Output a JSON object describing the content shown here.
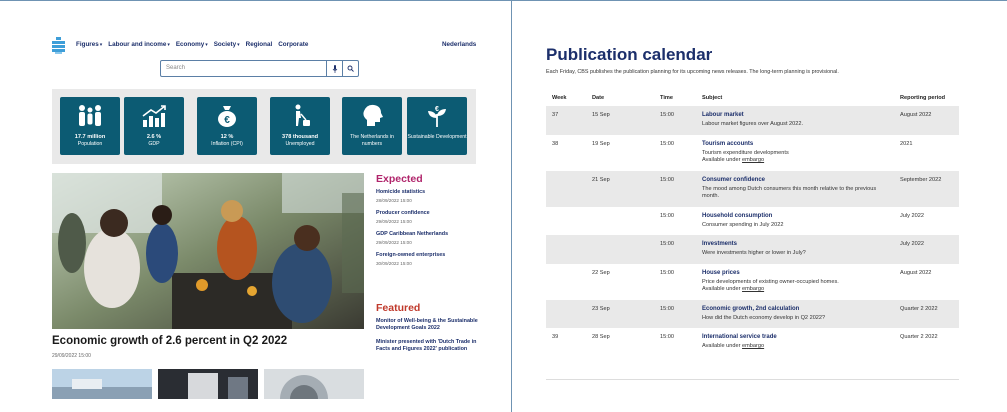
{
  "nav": {
    "items": [
      "Figures",
      "Labour and income",
      "Economy",
      "Society",
      "Regional",
      "Corporate"
    ],
    "has_caret": [
      true,
      true,
      true,
      true,
      false,
      false
    ],
    "language": "Nederlands"
  },
  "search": {
    "placeholder": "Search"
  },
  "tiles": [
    {
      "icon": "people-icon",
      "value": "17.7 million",
      "label": "Population"
    },
    {
      "icon": "growth-chart-icon",
      "value": "2.6 %",
      "label": "GDP"
    },
    {
      "icon": "money-bag-icon",
      "value": "12 %",
      "label": "Inflation (CPI)"
    },
    {
      "icon": "unemployed-person-icon",
      "value": "378 thousand",
      "label": "Unemployed"
    },
    {
      "icon": "head-profile-icon",
      "value": "",
      "label": "The Netherlands in numbers"
    },
    {
      "icon": "sustainable-plant-icon",
      "value": "",
      "label": "Sustainable Development"
    }
  ],
  "main_story": {
    "headline": "Economic growth of 2.6 percent in Q2 2022",
    "date": "29/09/2022 15:00"
  },
  "expected": {
    "heading": "Expected",
    "items": [
      {
        "title": "Homicide statistics",
        "date": "28/09/2022 15:00"
      },
      {
        "title": "Producer confidence",
        "date": "29/09/2022 15:00"
      },
      {
        "title": "GDP Caribbean Netherlands",
        "date": "29/09/2022 15:00"
      },
      {
        "title": "Foreign-owned enterprises",
        "date": "30/09/2022 15:00"
      }
    ]
  },
  "featured": {
    "heading": "Featured",
    "items": [
      {
        "title": "Monitor of Well-being & the Sustainable Development Goals 2022"
      },
      {
        "title": "Minister presented with 'Dutch Trade in Facts and Figures 2022' publication"
      }
    ]
  },
  "calendar": {
    "title": "Publication calendar",
    "intro": "Each Friday, CBS publishes the publication planning for its upcoming news releases. The long-term planning is provisional.",
    "columns": [
      "Week",
      "Date",
      "Time",
      "Subject",
      "Reporting period"
    ],
    "embargo_word": "embargo",
    "rows": [
      {
        "week": "37",
        "date": "15 Sep",
        "time": "15:00",
        "subject": "Labour market",
        "desc": "Labour market figures over August 2022.",
        "embargo": "",
        "period": "August 2022"
      },
      {
        "week": "38",
        "date": "19 Sep",
        "time": "15:00",
        "subject": "Tourism accounts",
        "desc": "Tourism expenditure developments",
        "embargo": "Available under",
        "period": "2021"
      },
      {
        "week": "",
        "date": "21 Sep",
        "time": "15:00",
        "subject": "Consumer confidence",
        "desc": "The mood among Dutch consumers this month relative to the previous month.",
        "embargo": "",
        "period": "September 2022"
      },
      {
        "week": "",
        "date": "",
        "time": "15:00",
        "subject": "Household consumption",
        "desc": "Consumer spending in July 2022",
        "embargo": "",
        "period": "July 2022"
      },
      {
        "week": "",
        "date": "",
        "time": "15:00",
        "subject": "Investments",
        "desc": "Were investments higher or lower in July?",
        "embargo": "",
        "period": "July 2022"
      },
      {
        "week": "",
        "date": "22 Sep",
        "time": "15:00",
        "subject": "House prices",
        "desc": "Price developments of existing owner-occupied homes.",
        "embargo": "Available under",
        "period": "August 2022"
      },
      {
        "week": "",
        "date": "23 Sep",
        "time": "15:00",
        "subject": "Economic growth, 2nd calculation",
        "desc": "How did the Dutch economy develop in Q2 2022?",
        "embargo": "",
        "period": "Quarter 2 2022"
      },
      {
        "week": "39",
        "date": "28 Sep",
        "time": "15:00",
        "subject": "International service trade",
        "desc": "",
        "embargo": "Available under",
        "period": "Quarter 2 2022"
      }
    ]
  },
  "colors": {
    "navy": "#1c2f6b",
    "tile_teal": "#0c5b73",
    "accent_magenta": "#b0246b",
    "accent_red": "#c0392b",
    "logo_blue": "#3e9ed8",
    "alt_row": "#e9e9e9"
  }
}
